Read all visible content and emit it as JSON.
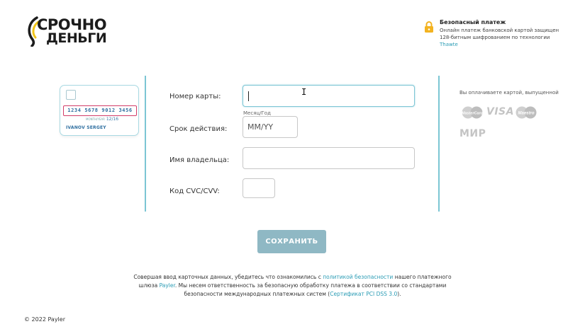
{
  "logo": {
    "line1": "СРОЧНО",
    "line2": "ДЕНЬГИ"
  },
  "secure": {
    "title": "Безопасный платеж",
    "desc_prefix": "Онлайн платеж банковской картой защищен 128-битным шифрованием по технологии ",
    "desc_link": "Thawte"
  },
  "card_illustration": {
    "number": "1234 5678 9012 3456",
    "exp_prefix": "MONTH/YEAR",
    "exp": "12/16",
    "holder": "IVANOV SERGEY"
  },
  "form": {
    "card_number_label": "Номер карты:",
    "card_number_value": "",
    "expiry_hint": "Месяц/Год",
    "expiry_label": "Срок действия:",
    "expiry_placeholder": "MM/YY",
    "holder_label": "Имя владельца:",
    "holder_value": "",
    "cvc_label": "Код CVC/CVV:",
    "cvc_value": ""
  },
  "payment_brands": {
    "title": "Вы оплачиваете картой, выпущенной",
    "items": [
      "MasterCard",
      "VISA",
      "Maestro",
      "МИР"
    ]
  },
  "save_button": "СОХРАНИТЬ",
  "notice": {
    "part1": "Совершая ввод карточных данных, убедитесь что ознакомились с ",
    "link1": "политикой безопасности",
    "part2": " нашего платежного шлюза ",
    "link2": "Payler",
    "part3": ". Мы несем ответственность за безопасную обработку платежа в соответствии со стандартами безопасности международных платежных систем (",
    "link3": "Сертификат PCI DSS 3.0",
    "part4": ")."
  },
  "copyright": "© 2022 Payler",
  "colors": {
    "accent": "#7cc6d4",
    "button": "#8fb8c4",
    "link": "#2b9cb5",
    "card_number_border": "#d23c68"
  }
}
